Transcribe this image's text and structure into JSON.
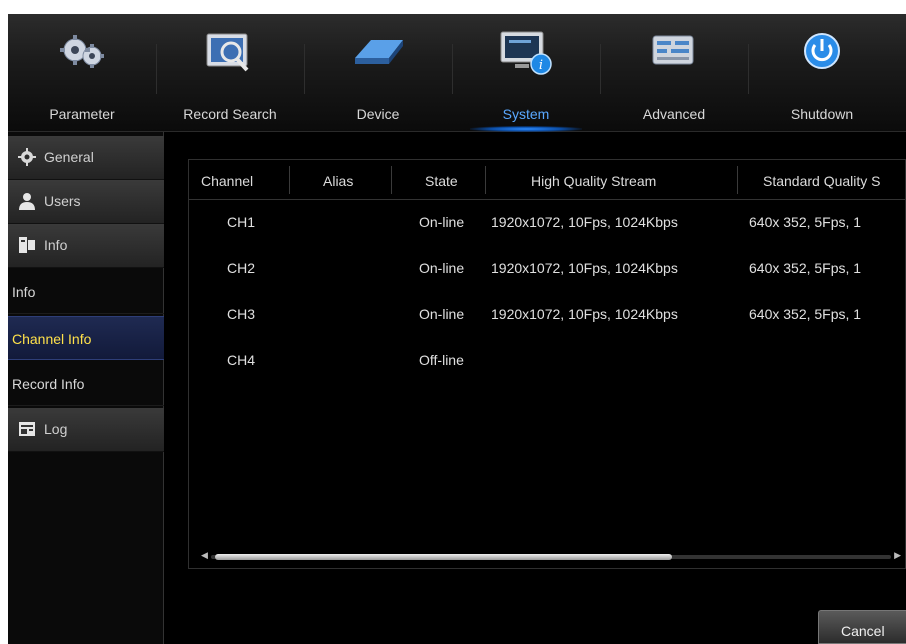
{
  "nav": {
    "items": [
      {
        "label": "Parameter",
        "icon": "gears-icon"
      },
      {
        "label": "Record Search",
        "icon": "record-search-icon"
      },
      {
        "label": "Device",
        "icon": "hard-disk-icon"
      },
      {
        "label": "System",
        "icon": "system-info-icon"
      },
      {
        "label": "Advanced",
        "icon": "advanced-icon"
      },
      {
        "label": "Shutdown",
        "icon": "power-icon"
      }
    ],
    "active": "System",
    "accent_color": "#2f8cff"
  },
  "sidebar": {
    "general": "General",
    "users": "Users",
    "info": "Info",
    "info_sub": "Info",
    "channel_info": "Channel Info",
    "record_info": "Record Info",
    "log": "Log",
    "active": "Channel Info",
    "active_color": "#ffe14a"
  },
  "table": {
    "headers": [
      "Channel",
      "Alias",
      "State",
      "High Quality Stream",
      "Standard Quality S"
    ],
    "rows": [
      {
        "channel": "CH1",
        "alias": "",
        "state": "On-line",
        "hq": "1920x1072, 10Fps,  1024Kbps",
        "sq": "640x 352,  5Fps,  1"
      },
      {
        "channel": "CH2",
        "alias": "",
        "state": "On-line",
        "hq": "1920x1072, 10Fps,  1024Kbps",
        "sq": "640x 352,  5Fps,  1"
      },
      {
        "channel": "CH3",
        "alias": "",
        "state": "On-line",
        "hq": "1920x1072, 10Fps,  1024Kbps",
        "sq": "640x 352,  5Fps,  1"
      },
      {
        "channel": "CH4",
        "alias": "",
        "state": "Off-line",
        "hq": "",
        "sq": ""
      }
    ],
    "scroll_fraction": 0.68
  },
  "buttons": {
    "cancel": "Cancel"
  }
}
